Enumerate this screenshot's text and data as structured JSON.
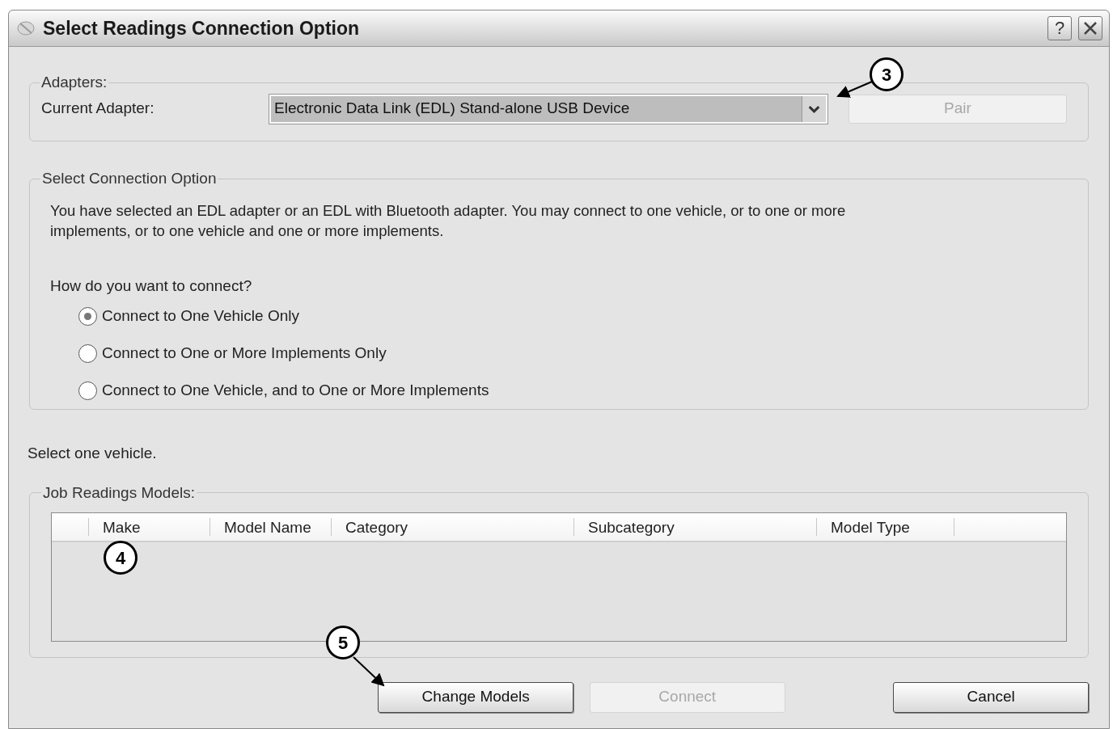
{
  "window": {
    "title": "Select Readings Connection Option",
    "help_button": "?"
  },
  "adapters": {
    "legend": "Adapters:",
    "label": "Current Adapter:",
    "dropdown": {
      "value": "Electronic Data Link (EDL) Stand-alone USB Device"
    },
    "pair_button": {
      "label": "Pair",
      "disabled": true
    }
  },
  "connection": {
    "legend": "Select Connection Option",
    "description": "You have selected an EDL adapter or an EDL with Bluetooth adapter. You may connect to one vehicle, or to one or more implements, or to one vehicle and one or more implements.",
    "question": "How do you want to connect?",
    "options": [
      {
        "label": "Connect to One Vehicle Only",
        "selected": true
      },
      {
        "label": "Connect to One or More Implements Only",
        "selected": false
      },
      {
        "label": "Connect to One Vehicle, and to One or More Implements",
        "selected": false
      }
    ]
  },
  "instruction": "Select one vehicle.",
  "models": {
    "legend": "Job Readings Models:",
    "columns": [
      "Make",
      "Model Name",
      "Category",
      "Subcategory",
      "Model Type"
    ]
  },
  "buttons": [
    {
      "label": "Change Models",
      "disabled": false
    },
    {
      "label": "Connect",
      "disabled": true
    },
    {
      "label": "Cancel",
      "disabled": false
    }
  ],
  "callouts": [
    {
      "label": "3"
    },
    {
      "label": "4"
    },
    {
      "label": "5"
    }
  ]
}
